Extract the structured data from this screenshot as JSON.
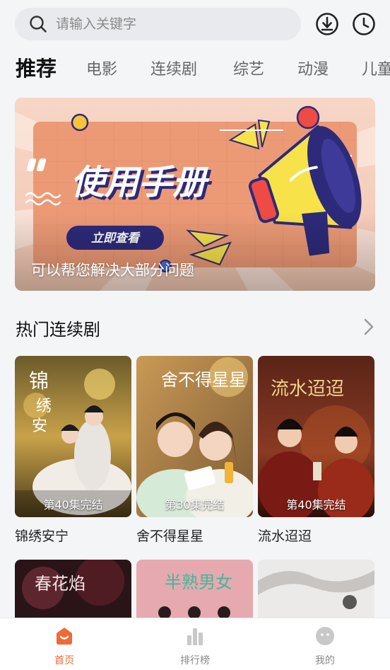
{
  "search": {
    "placeholder": "请输入关键字"
  },
  "header_icons": [
    "download-icon",
    "history-icon"
  ],
  "tabs": [
    "推荐",
    "电影",
    "连续剧",
    "综艺",
    "动漫",
    "儿童"
  ],
  "active_tab": "推荐",
  "banner": {
    "title": "使用手册",
    "button": "立即查看",
    "caption": "可以帮您解决大部分问题"
  },
  "section": {
    "title": "热门连续剧"
  },
  "cards": [
    {
      "title": "锦绣安宁",
      "episodes": "第40集完结"
    },
    {
      "title": "舍不得星星",
      "episodes": "第30集完结"
    },
    {
      "title": "流水迢迢",
      "episodes": "第40集完结"
    }
  ],
  "nav": [
    {
      "label": "首页"
    },
    {
      "label": "排行榜"
    },
    {
      "label": "我的"
    }
  ],
  "colors": {
    "accent": "#f06a35",
    "background": "#f4f5f7"
  }
}
